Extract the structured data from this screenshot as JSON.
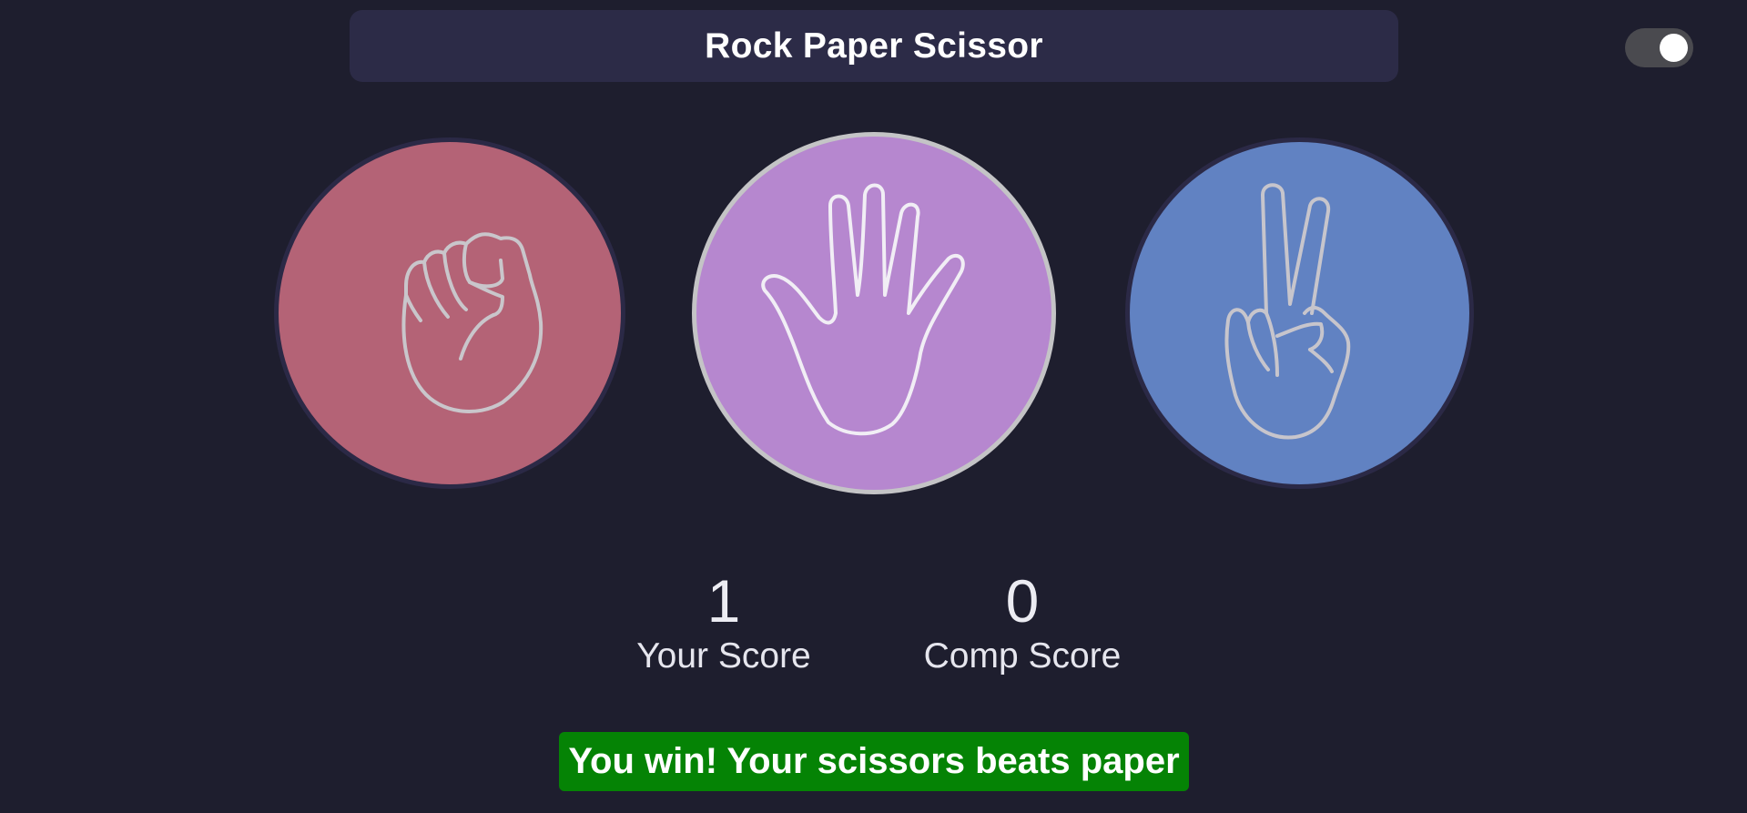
{
  "header": {
    "title": "Rock Paper Scissor"
  },
  "theme_toggle": {
    "state": "on"
  },
  "choices": [
    {
      "id": "rock",
      "icon": "fist-icon",
      "color": "#b46376"
    },
    {
      "id": "paper",
      "icon": "open-hand-icon",
      "color": "#b687cf"
    },
    {
      "id": "scissors",
      "icon": "peace-sign-icon",
      "color": "#6182c2"
    }
  ],
  "scoreboard": {
    "user_score": "1",
    "user_label": "Your Score",
    "comp_score": "0",
    "comp_label": "Comp Score"
  },
  "message": {
    "text": "You win! Your scissors beats paper",
    "color": "#058305"
  },
  "colors": {
    "background": "#1e1e2e",
    "title_bar": "#2c2b47"
  }
}
